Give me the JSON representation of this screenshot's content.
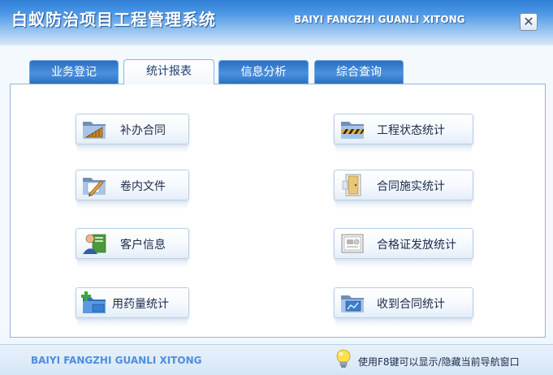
{
  "window": {
    "title": "白蚁防治项目工程管理系统",
    "subtitle": "BAIYI FANGZHI GUANLI XITONG",
    "close_glyph": "✕"
  },
  "tabs": [
    {
      "label": "业务登记",
      "active": false
    },
    {
      "label": "统计报表",
      "active": true
    },
    {
      "label": "信息分析",
      "active": false
    },
    {
      "label": "综合查询",
      "active": false
    }
  ],
  "buttons": {
    "left": [
      {
        "label": "补办合同",
        "icon": "folder-ruler-icon"
      },
      {
        "label": "卷内文件",
        "icon": "folder-pen-icon"
      },
      {
        "label": "客户信息",
        "icon": "customer-person-icon"
      },
      {
        "label": "用药量统计",
        "icon": "folder-add-icon"
      }
    ],
    "right": [
      {
        "label": "工程状态统计",
        "icon": "folder-hazard-stripe-icon"
      },
      {
        "label": "合同施实统计",
        "icon": "contract-door-icon"
      },
      {
        "label": "合格证发放统计",
        "icon": "certificate-icon"
      },
      {
        "label": "收到合同统计",
        "icon": "folder-chart-icon"
      }
    ]
  },
  "footer": {
    "brand": "BAIYI FANGZHI GUANLI XITONG",
    "hint": "使用F8键可以显示/隐藏当前导航窗口",
    "hint_icon": "lightbulb-icon"
  },
  "colors": {
    "title_bar": "#4d98e6",
    "tab_inactive": "#3b82d4",
    "panel_border": "#8fb5de",
    "footer_brand": "#4d8fdc"
  }
}
